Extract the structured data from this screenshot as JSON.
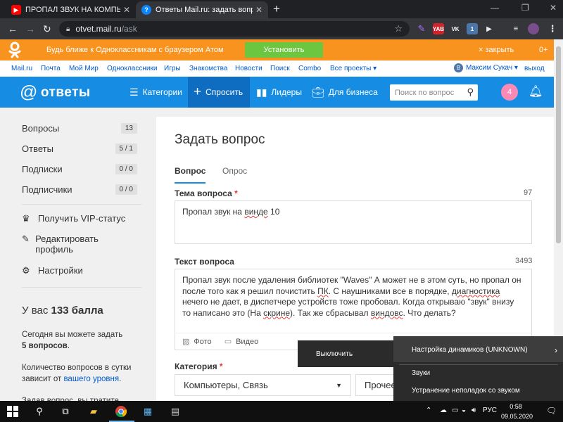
{
  "browser": {
    "tabs": [
      {
        "title": "ПРОПАЛ ЗВУК НА КОМПЬЮТЕР",
        "icon": "youtube-icon"
      },
      {
        "title": "Ответы Mail.ru: задать вопрос",
        "icon": "mailru-answers-icon"
      }
    ],
    "url_host": "otvet.mail.ru",
    "url_path": "/ask",
    "ext_badges": {
      "yab": "YAB",
      "vk": "VK",
      "vk_count": "1"
    }
  },
  "promo": {
    "text": "Будь ближе к Одноклассникам с браузером Атом",
    "install_label": "Установить",
    "close_label": "× закрыть",
    "badge": "0+"
  },
  "portal_nav": {
    "links": [
      "Mail.ru",
      "Почта",
      "Мой Мир",
      "Одноклассники",
      "Игры",
      "Знакомства",
      "Новости",
      "Поиск",
      "Combo",
      "Все проекты ▾"
    ],
    "user": "Максим Сукач ▾",
    "user_initial": "В",
    "logout": "выход"
  },
  "header": {
    "logo": "ответы",
    "nav": [
      "Категории",
      "Спросить",
      "Лидеры",
      "Для бизнеса"
    ],
    "search_placeholder": "Поиск по вопрос",
    "notifications": "4"
  },
  "sidebar": {
    "stats": [
      {
        "label": "Вопросы",
        "count": "13"
      },
      {
        "label": "Ответы",
        "count": "5 / 1"
      },
      {
        "label": "Подписки",
        "count": "0 / 0"
      },
      {
        "label": "Подписчики",
        "count": "0 / 0"
      }
    ],
    "actions": [
      {
        "label": "Получить VIP-статус",
        "icon": "vip-icon"
      },
      {
        "label": "Редактировать профиль",
        "icon": "edit-profile-icon"
      },
      {
        "label": "Настройки",
        "icon": "gear-icon"
      }
    ],
    "score_prefix": "У вас",
    "score_value": "133 балла",
    "today_prefix": "Сегодня вы можете задать",
    "today_value": "5 вопросов",
    "today_suffix": ".",
    "level_text": "Количество вопросов в сутки зависит от",
    "level_link": "вашего уровня",
    "level_suffix": ".",
    "cut_text": "Задав вопрос, вы тратите"
  },
  "form": {
    "title": "Задать вопрос",
    "tabs": [
      "Вопрос",
      "Опрос"
    ],
    "topic_label": "Тема вопроса",
    "topic_counter": "97",
    "topic_value_pre": "Пропал звук на ",
    "topic_value_err": "винде",
    "topic_value_post": " 10",
    "text_label": "Текст вопроса",
    "text_counter": "3493",
    "text_parts": [
      {
        "t": "Пропал звук после удаления библиотек \"Waves\" А может не в этом суть, но пропал он после того как я решил почистить ",
        "e": false
      },
      {
        "t": "ПК",
        "e": true
      },
      {
        "t": ". С наушниками все в порядке, ",
        "e": false
      },
      {
        "t": "диагностика",
        "e": true
      },
      {
        "t": " нечего не дает, в диспетчере устройств тоже пробовал. Когда открываю \"звук\" внизу то написано это (На ",
        "e": false
      },
      {
        "t": "скрине",
        "e": true
      },
      {
        "t": "). Так же сбрасывал ",
        "e": false
      },
      {
        "t": "виндовс",
        "e": true
      },
      {
        "t": ". Что делать?",
        "e": false
      }
    ],
    "attach_photo": "Фото",
    "attach_video": "Видео",
    "category_label": "Категория",
    "category_value": "Компьютеры, Связь",
    "subcategory_value": "Прочее"
  },
  "context_menu": {
    "left": "Выключить",
    "items": [
      "Настройка динамиков (UNKNOWN)",
      "Звуки",
      "Устранение неполадок со звуком"
    ]
  },
  "taskbar": {
    "lang": "РУС",
    "time": "0:58",
    "date": "09.05.2020"
  }
}
